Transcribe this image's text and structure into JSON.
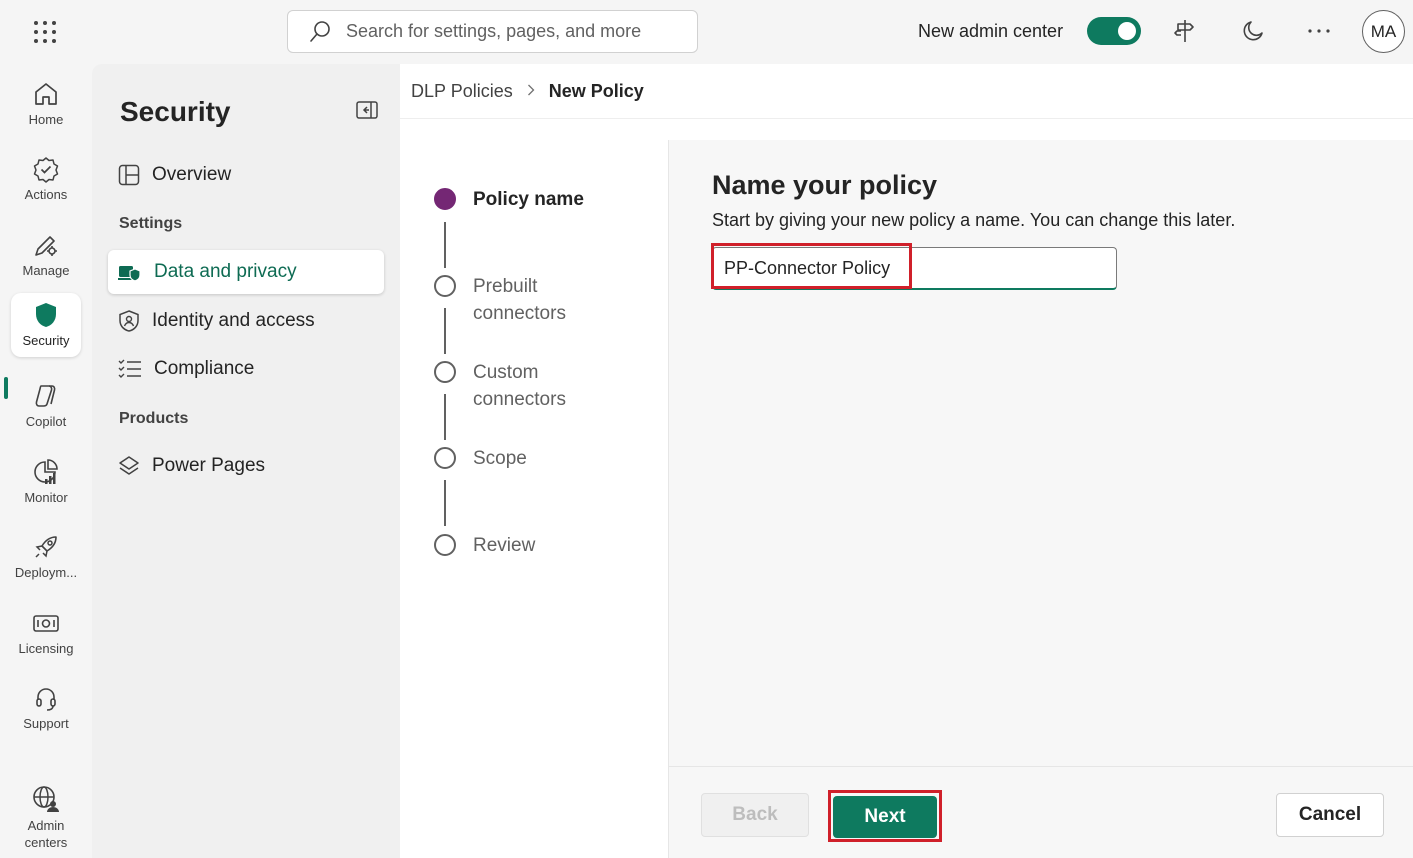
{
  "topbar": {
    "search_placeholder": "Search for settings, pages, and more",
    "new_admin_center_label": "New admin center",
    "new_admin_center_on": true,
    "avatar_initials": "MA"
  },
  "rail": {
    "items": [
      {
        "label": "Home",
        "icon": "home-icon"
      },
      {
        "label": "Actions",
        "icon": "actions-icon"
      },
      {
        "label": "Manage",
        "icon": "manage-icon"
      },
      {
        "label": "Security",
        "icon": "shield-icon",
        "active": true
      },
      {
        "label": "Copilot",
        "icon": "copilot-icon"
      },
      {
        "label": "Monitor",
        "icon": "monitor-icon"
      },
      {
        "label": "Deploym...",
        "icon": "deployment-icon"
      },
      {
        "label": "Licensing",
        "icon": "licensing-icon"
      },
      {
        "label": "Support",
        "icon": "support-icon"
      },
      {
        "label": "Admin centers",
        "icon": "admin-centers-icon"
      }
    ]
  },
  "security_panel": {
    "title": "Security",
    "overview": "Overview",
    "settings_header": "Settings",
    "data_privacy": "Data and privacy",
    "identity_access": "Identity and access",
    "compliance": "Compliance",
    "products_header": "Products",
    "power_pages": "Power Pages"
  },
  "breadcrumb": {
    "parent": "DLP Policies",
    "current": "New Policy"
  },
  "stepper": {
    "steps": [
      {
        "label": "Policy name",
        "state": "current"
      },
      {
        "label": "Prebuilt connectors",
        "state": "pending"
      },
      {
        "label": "Custom connectors",
        "state": "pending"
      },
      {
        "label": "Scope",
        "state": "pending"
      },
      {
        "label": "Review",
        "state": "pending"
      }
    ]
  },
  "content": {
    "title": "Name your policy",
    "description": "Start by giving your new policy a name. You can change this later.",
    "policy_name_value": "PP-Connector Policy"
  },
  "footer": {
    "back_label": "Back",
    "next_label": "Next",
    "cancel_label": "Cancel"
  },
  "colors": {
    "accent": "#0e7a5f",
    "step_current": "#742774",
    "highlight": "#d0202a"
  }
}
